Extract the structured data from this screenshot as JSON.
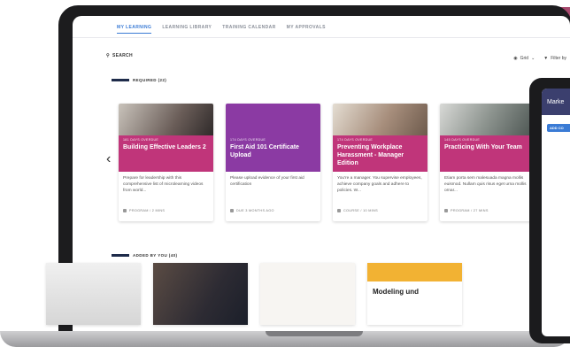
{
  "tabs": [
    "MY LEARNING",
    "LEARNING LIBRARY",
    "TRAINING CALENDAR",
    "MY APPROVALS"
  ],
  "search_label": "SEARCH",
  "toolbar": {
    "grid": "Grid",
    "filter": "Filter by"
  },
  "sections": {
    "required": "REQUIRED (22)",
    "added": "ADDED BY YOU (40)"
  },
  "cards": [
    {
      "overdue": "181 DAYS OVERDUE",
      "title": "Building Effective Leaders 2",
      "desc": "Prepare for leadership with this comprehensive list of microlearning videos from world...",
      "meta": "PROGRAM / 2 MINS"
    },
    {
      "overdue": "174 DAYS OVERDUE",
      "title": "First Aid 101 Certificate Upload",
      "desc": "Please upload evidence of your first aid certification",
      "meta": "DUE 3 MONTHS AGO"
    },
    {
      "overdue": "174 DAYS OVERDUE",
      "title": "Preventing Workplace Harassment - Manager Edition",
      "desc": "You're a manager. You supervise employees, achieve company goals and adhere to policies. W...",
      "meta": "COURSE / 10 MINS"
    },
    {
      "overdue": "145 DAYS OVERDUE",
      "title": "Practicing With Your Team",
      "desc": "Etiam porta sem malesuada magna mollis euismod. Nullam quis risus eget urna mollis ornar...",
      "meta": "PROGRAM / 27 MINS"
    }
  ],
  "added_cards": [
    {
      "title": ""
    },
    {
      "title": ""
    },
    {
      "title": ""
    },
    {
      "title": "Modeling und"
    }
  ],
  "phone": {
    "header": "Marke",
    "button": "ADD CO"
  }
}
